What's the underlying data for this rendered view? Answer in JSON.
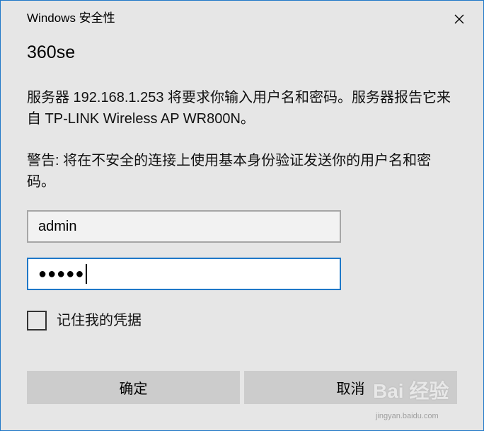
{
  "window": {
    "title": "Windows 安全性",
    "close_icon": "close-icon"
  },
  "prompt": {
    "site": "360se",
    "message": "服务器 192.168.1.253 将要求你输入用户名和密码。服务器报告它来自 TP-LINK Wireless AP WR800N。",
    "warning": "警告: 将在不安全的连接上使用基本身份验证发送你的用户名和密码。"
  },
  "form": {
    "username_value": "admin",
    "password_masked": "●●●●●",
    "remember_label": "记住我的凭据",
    "remember_checked": false
  },
  "buttons": {
    "ok_label": "确定",
    "cancel_label": "取消"
  },
  "watermark": {
    "text": "Bai 经验",
    "url": "jingyan.baidu.com"
  },
  "colors": {
    "accent": "#1f78c8",
    "dialog_bg": "#e6e6e6",
    "button_bg": "#cccccc"
  }
}
